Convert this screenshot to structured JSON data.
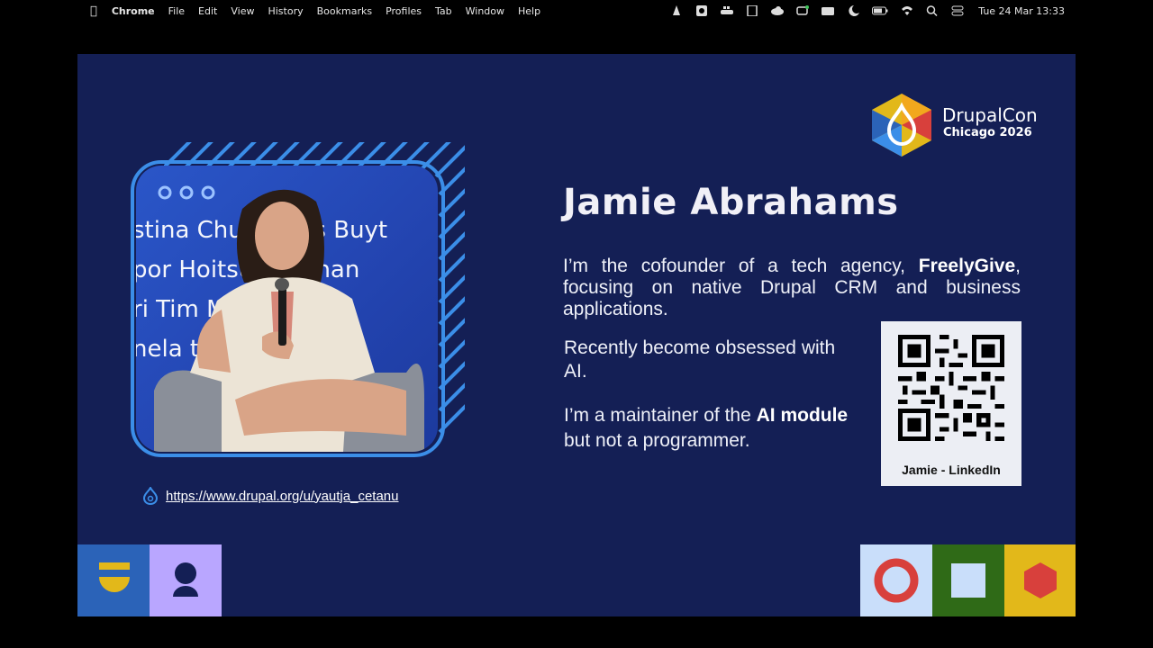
{
  "menubar": {
    "app_name": "Chrome",
    "menus": [
      "File",
      "Edit",
      "View",
      "History",
      "Bookmarks",
      "Profiles",
      "Tab",
      "Window",
      "Help"
    ],
    "clock": "Tue 24 Mar  13:33"
  },
  "slide": {
    "logo": {
      "title": "DrupalCon",
      "subtitle": "Chicago 2026"
    },
    "speaker_name": "Jamie Abrahams",
    "intro_prefix": "I’m the cofounder of a tech agency, ",
    "intro_company": "FreelyGive",
    "intro_suffix": ", focusing on native Drupal CRM and business applications.",
    "obsessed": "Recently become obsessed with AI.",
    "maintainer_prefix": "I’m a maintainer of the ",
    "maintainer_bold": "AI module",
    "maintainer_suffix": " but not a programmer.",
    "qr_caption": "Jamie - LinkedIn",
    "profile_url": "https://www.drupal.org/u/yautja_cetanu",
    "photo_names": [
      "stina Chun   Dries Buyt",
      "por Hoitsu     Abrahan",
      "ri Tim                 Mosk",
      "nela                      tt"
    ]
  },
  "colors": {
    "slide_bg": "#141f55",
    "accent_blue": "#3b8ee8",
    "tile_blue": "#2b63b8",
    "tile_lavender": "#b9a6ff",
    "tile_light": "#c9defa",
    "tile_green": "#2f6a17",
    "tile_yellow": "#e2b81a",
    "shape_red": "#d8403c"
  },
  "icons": [
    "apple-icon",
    "drupal-drop-icon",
    "wifi-icon",
    "battery-icon",
    "search-icon",
    "moon-icon"
  ]
}
